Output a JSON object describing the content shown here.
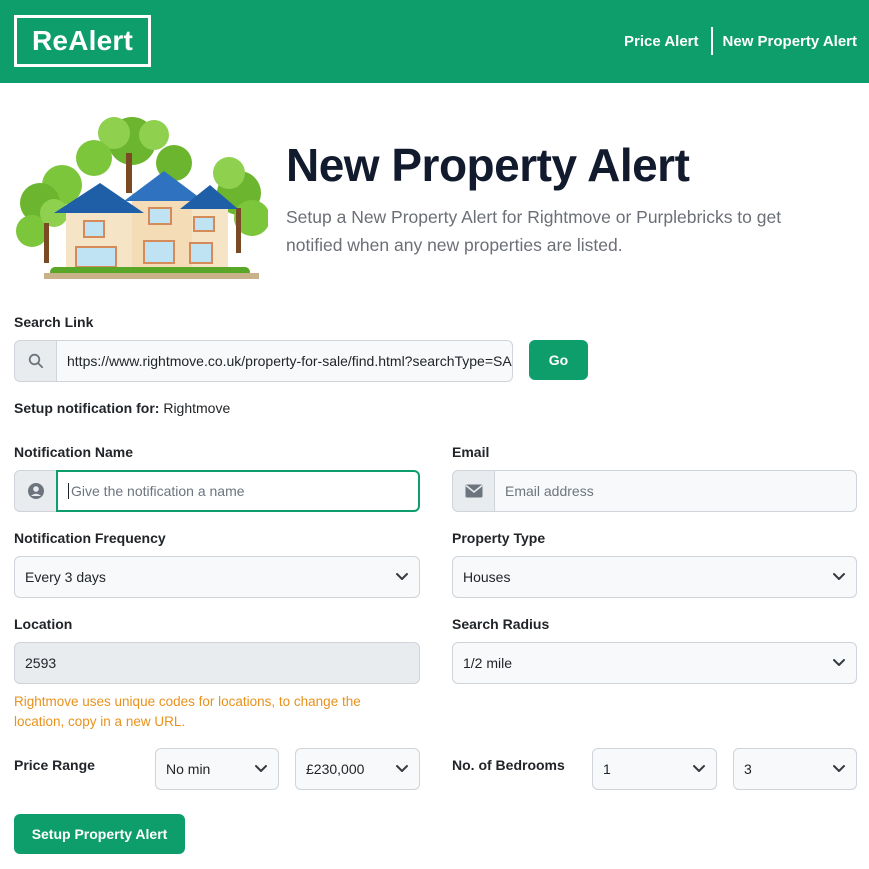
{
  "navbar": {
    "logo": "ReAlert",
    "links": [
      "Price Alert",
      "New Property Alert"
    ]
  },
  "hero": {
    "title": "New Property Alert",
    "subtitle": "Setup a New Property Alert for Rightmove or Purplebricks to get notified when any new properties are listed."
  },
  "search": {
    "label": "Search Link",
    "value": "https://www.rightmove.co.uk/property-for-sale/find.html?searchType=SALE",
    "go_label": "Go",
    "icon": "search-icon"
  },
  "setup_for": {
    "label": "Setup notification for:",
    "value": "Rightmove"
  },
  "form": {
    "notification_name": {
      "label": "Notification Name",
      "placeholder": "Give the notification a name",
      "icon": "user-circle-icon"
    },
    "email": {
      "label": "Email",
      "placeholder": "Email address",
      "icon": "envelope-icon"
    },
    "frequency": {
      "label": "Notification Frequency",
      "value": "Every 3 days"
    },
    "property_type": {
      "label": "Property Type",
      "value": "Houses"
    },
    "location": {
      "label": "Location",
      "value": "2593"
    },
    "radius": {
      "label": "Search Radius",
      "value": "1/2 mile"
    },
    "location_note": "Rightmove uses unique codes for locations, to change the location, copy in a new URL.",
    "price_range": {
      "label": "Price Range",
      "min": "No min",
      "max": "£230,000"
    },
    "bedrooms": {
      "label": "No. of Bedrooms",
      "min": "1",
      "max": "3"
    },
    "submit_label": "Setup Property Alert"
  },
  "colors": {
    "brand": "#0e9e6c",
    "note": "#e8921c"
  }
}
